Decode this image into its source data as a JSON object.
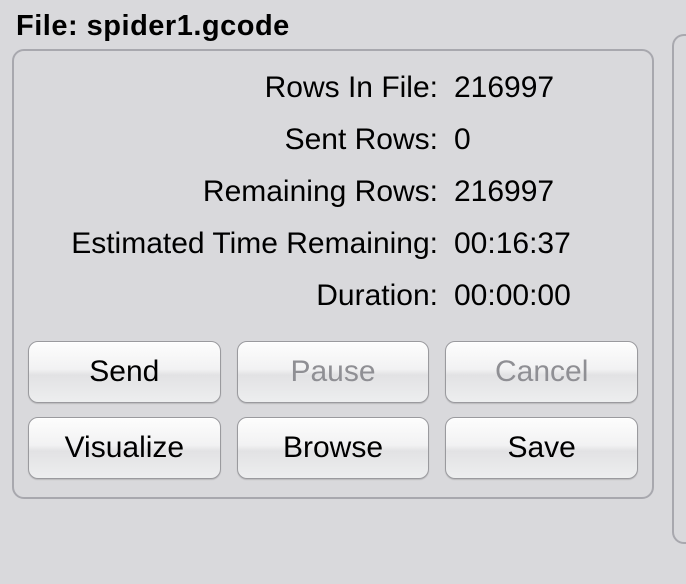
{
  "header": {
    "prefix": "File: ",
    "filename": "spider1.gcode"
  },
  "stats": {
    "rows_in_file": {
      "label": "Rows In File:",
      "value": "216997"
    },
    "sent_rows": {
      "label": "Sent Rows:",
      "value": "0"
    },
    "remaining_rows": {
      "label": "Remaining Rows:",
      "value": "216997"
    },
    "est_time_remaining": {
      "label": "Estimated Time Remaining:",
      "value": "00:16:37"
    },
    "duration": {
      "label": "Duration:",
      "value": "00:00:00"
    }
  },
  "buttons": {
    "send": "Send",
    "pause": "Pause",
    "cancel": "Cancel",
    "visualize": "Visualize",
    "browse": "Browse",
    "save": "Save"
  }
}
